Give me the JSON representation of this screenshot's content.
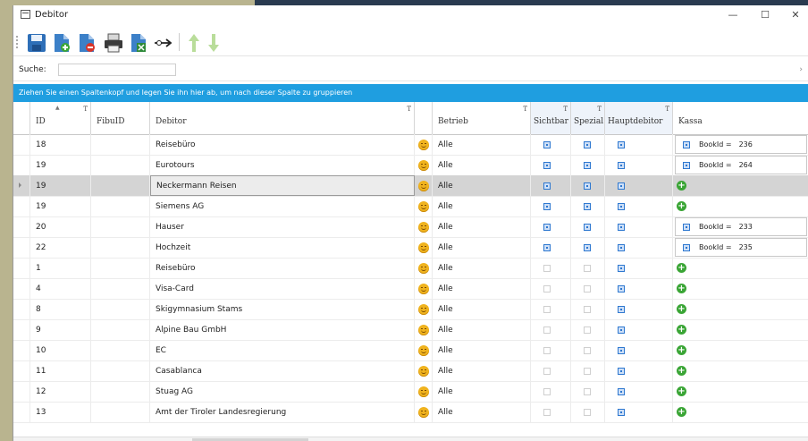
{
  "window": {
    "title": "Debitor",
    "minimize_glyph": "—",
    "maximize_glyph": "☐",
    "close_glyph": "✕"
  },
  "toolbar": {
    "buttons": [
      {
        "name": "save-button",
        "icon": "floppy-disk-icon"
      },
      {
        "name": "new-button",
        "icon": "document-add-icon"
      },
      {
        "name": "delete-button",
        "icon": "document-delete-icon"
      },
      {
        "name": "print-button",
        "icon": "printer-icon"
      },
      {
        "name": "export-button",
        "icon": "document-export-icon"
      },
      {
        "name": "link-button",
        "icon": "connector-arrow-icon"
      },
      {
        "name": "move-up-button",
        "icon": "arrow-up-icon"
      },
      {
        "name": "move-down-button",
        "icon": "arrow-down-icon"
      }
    ]
  },
  "search": {
    "label": "Suche:",
    "value": "",
    "scroll_glyph": "›"
  },
  "grouping_hint": "Ziehen Sie einen Spaltenkopf und legen Sie ihn hier ab, um nach dieser Spalte zu gruppieren",
  "columns": {
    "id": "ID",
    "fibuid": "FibuID",
    "debitor": "Debitor",
    "betrieb": "Betrieb",
    "sichtbar": "Sichtbar",
    "spezial": "Spezial",
    "hauptdebitor": "Hauptdebitor",
    "kassa": "Kassa",
    "filter_glyph": "T",
    "sort_glyph": "▲"
  },
  "colors": {
    "group_bar": "#1f9ee0",
    "checkbox_on": "#2e78d0",
    "plus": "#3aa535",
    "smiley": "#f0b31e"
  },
  "rows": [
    {
      "id": "18",
      "fibuid": "",
      "debitor": "Reisebüro",
      "betrieb": "Alle",
      "sichtbar": true,
      "spezial": true,
      "haupt": true,
      "kassa_type": "booking",
      "kassa_label": "BookId =",
      "kassa_value": "236",
      "selected": false
    },
    {
      "id": "19",
      "fibuid": "",
      "debitor": "Eurotours",
      "betrieb": "Alle",
      "sichtbar": true,
      "spezial": true,
      "haupt": true,
      "kassa_type": "booking",
      "kassa_label": "BookId =",
      "kassa_value": "264",
      "selected": false
    },
    {
      "id": "19",
      "fibuid": "",
      "debitor": "Neckermann Reisen",
      "betrieb": "Alle",
      "sichtbar": true,
      "spezial": true,
      "haupt": true,
      "kassa_type": "plus",
      "selected": true
    },
    {
      "id": "19",
      "fibuid": "",
      "debitor": "Siemens AG",
      "betrieb": "Alle",
      "sichtbar": true,
      "spezial": true,
      "haupt": true,
      "kassa_type": "plus",
      "selected": false
    },
    {
      "id": "20",
      "fibuid": "",
      "debitor": "Hauser",
      "betrieb": "Alle",
      "sichtbar": true,
      "spezial": true,
      "haupt": true,
      "kassa_type": "booking",
      "kassa_label": "BookId =",
      "kassa_value": "233",
      "selected": false
    },
    {
      "id": "22",
      "fibuid": "",
      "debitor": "Hochzeit",
      "betrieb": "Alle",
      "sichtbar": true,
      "spezial": true,
      "haupt": true,
      "kassa_type": "booking",
      "kassa_label": "BookId =",
      "kassa_value": "235",
      "selected": false
    },
    {
      "id": "1",
      "fibuid": "",
      "debitor": "Reisebüro",
      "betrieb": "Alle",
      "sichtbar": false,
      "spezial": false,
      "haupt": true,
      "kassa_type": "plus",
      "selected": false
    },
    {
      "id": "4",
      "fibuid": "",
      "debitor": "Visa-Card",
      "betrieb": "Alle",
      "sichtbar": false,
      "spezial": false,
      "haupt": true,
      "kassa_type": "plus",
      "selected": false
    },
    {
      "id": "8",
      "fibuid": "",
      "debitor": "Skigymnasium Stams",
      "betrieb": "Alle",
      "sichtbar": false,
      "spezial": false,
      "haupt": true,
      "kassa_type": "plus",
      "selected": false
    },
    {
      "id": "9",
      "fibuid": "",
      "debitor": "Alpine Bau GmbH",
      "betrieb": "Alle",
      "sichtbar": false,
      "spezial": false,
      "haupt": true,
      "kassa_type": "plus",
      "selected": false
    },
    {
      "id": "10",
      "fibuid": "",
      "debitor": "EC",
      "betrieb": "Alle",
      "sichtbar": false,
      "spezial": false,
      "haupt": true,
      "kassa_type": "plus",
      "selected": false
    },
    {
      "id": "11",
      "fibuid": "",
      "debitor": "Casablanca",
      "betrieb": "Alle",
      "sichtbar": false,
      "spezial": false,
      "haupt": true,
      "kassa_type": "plus",
      "selected": false
    },
    {
      "id": "12",
      "fibuid": "",
      "debitor": "Stuag AG",
      "betrieb": "Alle",
      "sichtbar": false,
      "spezial": false,
      "haupt": true,
      "kassa_type": "plus",
      "selected": false
    },
    {
      "id": "13",
      "fibuid": "",
      "debitor": "Amt der Tiroler Landesregierung",
      "betrieb": "Alle",
      "sichtbar": false,
      "spezial": false,
      "haupt": true,
      "kassa_type": "plus",
      "selected": false
    }
  ]
}
